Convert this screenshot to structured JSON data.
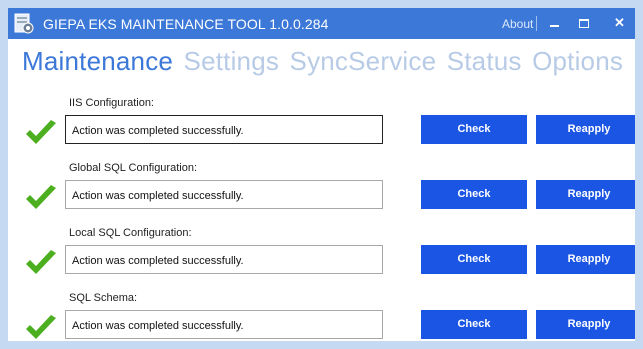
{
  "window": {
    "title": "GIEPA EKS MAINTENANCE TOOL 1.0.0.284",
    "about_label": "About",
    "icons": [
      "app-icon",
      "minimize-icon",
      "maximize-icon",
      "close-icon"
    ]
  },
  "tabs": [
    {
      "label": "Maintenance",
      "active": true
    },
    {
      "label": "Settings",
      "active": false
    },
    {
      "label": "SyncService",
      "active": false
    },
    {
      "label": "Status",
      "active": false
    },
    {
      "label": "Options",
      "active": false
    }
  ],
  "sections": [
    {
      "label": "IIS Configuration:",
      "status": "Action was completed successfully.",
      "check_label": "Check",
      "reapply_label": "Reapply"
    },
    {
      "label": "Global SQL Configuration:",
      "status": "Action was completed successfully.",
      "check_label": "Check",
      "reapply_label": "Reapply"
    },
    {
      "label": "Local SQL Configuration:",
      "status": "Action was completed successfully.",
      "check_label": "Check",
      "reapply_label": "Reapply"
    },
    {
      "label": "SQL Schema:",
      "status": "Action was completed successfully.",
      "check_label": "Check",
      "reapply_label": "Reapply"
    }
  ],
  "colors": {
    "accent": "#3c78d8",
    "button": "#1a55e3",
    "success": "#4caf1f",
    "inactive_tab": "#b8cbe6"
  }
}
